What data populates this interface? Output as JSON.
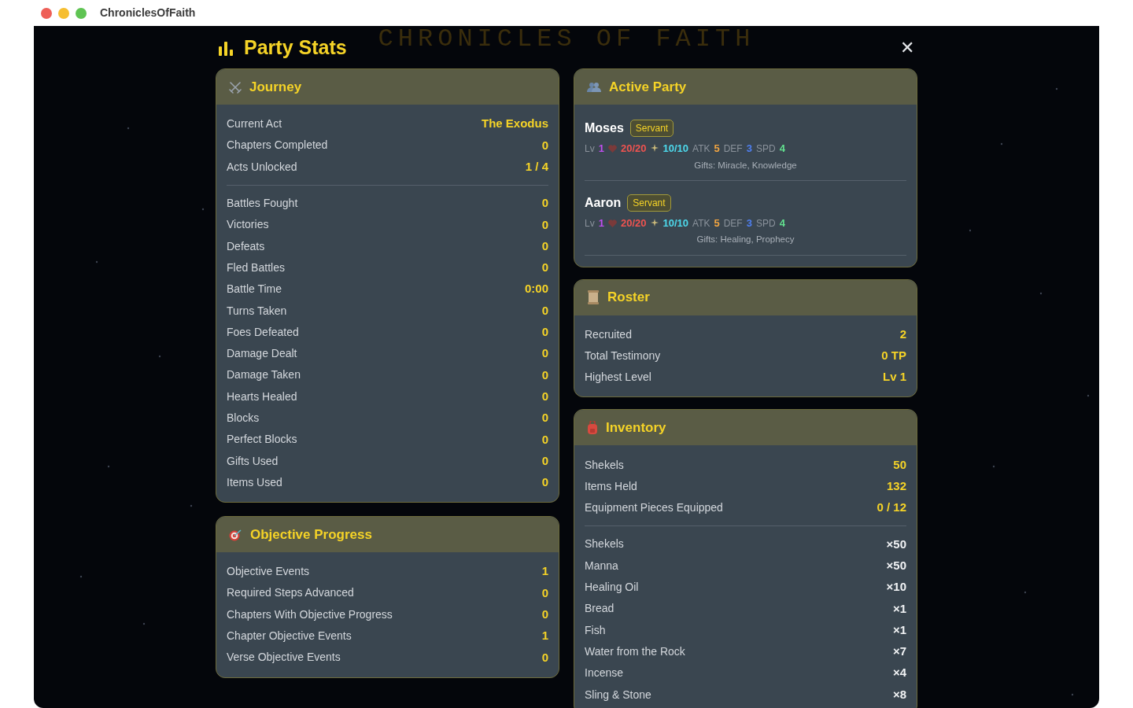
{
  "window": {
    "title": "ChroniclesOfFaith"
  },
  "background_title": "CHRONICLES OF FAITH",
  "modal": {
    "title": "Party Stats",
    "close": "✕"
  },
  "left_cards": [
    {
      "kind": "journey",
      "title": "Journey",
      "groups": [
        [
          {
            "label": "Current Act",
            "value": "The Exodus",
            "kind": "stat"
          },
          {
            "label": "Chapters Completed",
            "value": "0",
            "kind": "stat"
          },
          {
            "label": "Acts Unlocked",
            "value": "1 / 4",
            "kind": "stat"
          }
        ],
        [
          {
            "label": "Battles Fought",
            "value": "0",
            "kind": "stat"
          },
          {
            "label": "Victories",
            "value": "0",
            "kind": "stat"
          },
          {
            "label": "Defeats",
            "value": "0",
            "kind": "stat"
          },
          {
            "label": "Fled Battles",
            "value": "0",
            "kind": "stat"
          },
          {
            "label": "Battle Time",
            "value": "0:00",
            "kind": "stat"
          },
          {
            "label": "Turns Taken",
            "value": "0",
            "kind": "stat"
          },
          {
            "label": "Foes Defeated",
            "value": "0",
            "kind": "stat"
          },
          {
            "label": "Damage Dealt",
            "value": "0",
            "kind": "stat"
          },
          {
            "label": "Damage Taken",
            "value": "0",
            "kind": "stat"
          },
          {
            "label": "Hearts Healed",
            "value": "0",
            "kind": "stat"
          },
          {
            "label": "Blocks",
            "value": "0",
            "kind": "stat"
          },
          {
            "label": "Perfect Blocks",
            "value": "0",
            "kind": "stat"
          },
          {
            "label": "Gifts Used",
            "value": "0",
            "kind": "stat"
          },
          {
            "label": "Items Used",
            "value": "0",
            "kind": "stat"
          }
        ]
      ]
    },
    {
      "kind": "objective",
      "title": "Objective Progress",
      "groups": [
        [
          {
            "label": "Objective Events",
            "value": "1",
            "kind": "stat"
          },
          {
            "label": "Required Steps Advanced",
            "value": "0",
            "kind": "stat"
          },
          {
            "label": "Chapters With Objective Progress",
            "value": "0",
            "kind": "stat"
          },
          {
            "label": "Chapter Objective Events",
            "value": "1",
            "kind": "stat"
          },
          {
            "label": "Verse Objective Events",
            "value": "0",
            "kind": "stat"
          }
        ]
      ]
    }
  ],
  "active_party": {
    "kind": "party",
    "title": "Active Party",
    "members": [
      {
        "name": "Moses",
        "badge": "Servant",
        "stats": [
          {
            "kind": "label",
            "text": "Lv"
          },
          {
            "kind": "value",
            "text": "1",
            "color": "#c04ef0"
          },
          {
            "kind": "heart"
          },
          {
            "kind": "value",
            "text": "20/20",
            "color": "#ef5350"
          },
          {
            "kind": "sparkle"
          },
          {
            "kind": "value",
            "text": "10/10",
            "color": "#4dd9ec"
          },
          {
            "kind": "label",
            "text": "ATK"
          },
          {
            "kind": "value",
            "text": "5",
            "color": "#f2a541"
          },
          {
            "kind": "label",
            "text": "DEF"
          },
          {
            "kind": "value",
            "text": "3",
            "color": "#4f7ff0"
          },
          {
            "kind": "label",
            "text": "SPD"
          },
          {
            "kind": "value",
            "text": "4",
            "color": "#62e08f"
          }
        ],
        "gifts": "Gifts: Miracle, Knowledge"
      },
      {
        "name": "Aaron",
        "badge": "Servant",
        "stats": [
          {
            "kind": "label",
            "text": "Lv"
          },
          {
            "kind": "value",
            "text": "1",
            "color": "#c04ef0"
          },
          {
            "kind": "heart"
          },
          {
            "kind": "value",
            "text": "20/20",
            "color": "#ef5350"
          },
          {
            "kind": "sparkle"
          },
          {
            "kind": "value",
            "text": "10/10",
            "color": "#4dd9ec"
          },
          {
            "kind": "label",
            "text": "ATK"
          },
          {
            "kind": "value",
            "text": "5",
            "color": "#f2a541"
          },
          {
            "kind": "label",
            "text": "DEF"
          },
          {
            "kind": "value",
            "text": "3",
            "color": "#4f7ff0"
          },
          {
            "kind": "label",
            "text": "SPD"
          },
          {
            "kind": "value",
            "text": "4",
            "color": "#62e08f"
          }
        ],
        "gifts": "Gifts: Healing, Prophecy"
      }
    ]
  },
  "right_cards": [
    {
      "kind": "roster",
      "title": "Roster",
      "groups": [
        [
          {
            "label": "Recruited",
            "value": "2",
            "kind": "stat"
          },
          {
            "label": "Total Testimony",
            "value": "0 TP",
            "kind": "stat"
          },
          {
            "label": "Highest Level",
            "value": "Lv 1",
            "kind": "stat"
          }
        ]
      ]
    },
    {
      "kind": "inventory",
      "title": "Inventory",
      "groups": [
        [
          {
            "label": "Shekels",
            "value": "50",
            "kind": "stat"
          },
          {
            "label": "Items Held",
            "value": "132",
            "kind": "stat"
          },
          {
            "label": "Equipment Pieces Equipped",
            "value": "0 / 12",
            "kind": "stat"
          }
        ],
        [
          {
            "label": "Shekels",
            "value": "×50",
            "kind": "item"
          },
          {
            "label": "Manna",
            "value": "×50",
            "kind": "item"
          },
          {
            "label": "Healing Oil",
            "value": "×10",
            "kind": "item"
          },
          {
            "label": "Bread",
            "value": "×1",
            "kind": "item"
          },
          {
            "label": "Fish",
            "value": "×1",
            "kind": "item"
          },
          {
            "label": "Water from the Rock",
            "value": "×7",
            "kind": "item"
          },
          {
            "label": "Incense",
            "value": "×4",
            "kind": "item"
          },
          {
            "label": "Sling & Stone",
            "value": "×8",
            "kind": "item"
          }
        ]
      ]
    }
  ]
}
